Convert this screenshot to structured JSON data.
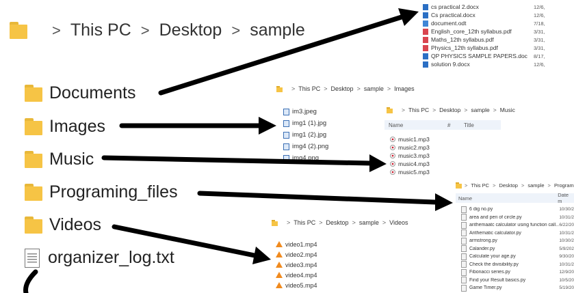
{
  "breadcrumb_main": [
    "This PC",
    "Desktop",
    "sample"
  ],
  "main_list": [
    "Documents",
    "Images",
    "Music",
    "Programing_files",
    "Videos",
    "organizer_log.txt"
  ],
  "documents_panel": {
    "files": [
      {
        "name": "cs practical 2.docx",
        "date": "12/6,",
        "type": "word"
      },
      {
        "name": "Cs practical.docx",
        "date": "12/6,",
        "type": "word"
      },
      {
        "name": "document.odt",
        "date": "7/18,",
        "type": "odt"
      },
      {
        "name": "English_core_12th syllabus.pdf",
        "date": "3/31,",
        "type": "pdf"
      },
      {
        "name": "Maths_12th syllabus.pdf",
        "date": "3/31,",
        "type": "pdf"
      },
      {
        "name": "Physics_12th syllabus.pdf",
        "date": "3/31,",
        "type": "pdf"
      },
      {
        "name": "QP PHYSICS SAMPLE PAPERS.doc",
        "date": "8/17,",
        "type": "word"
      },
      {
        "name": "solution 9.docx",
        "date": "12/6,",
        "type": "word"
      }
    ]
  },
  "images_panel": {
    "breadcrumb": [
      "This PC",
      "Desktop",
      "sample",
      "Images"
    ],
    "files": [
      "im3.jpeg",
      "img1 (1).jpg",
      "img1 (2).jpg",
      "img4 (2).png",
      "img4.png"
    ]
  },
  "music_panel": {
    "breadcrumb": [
      "This PC",
      "Desktop",
      "sample",
      "Music"
    ],
    "col_name": "Name",
    "col_hash": "#",
    "col_title": "Title",
    "files": [
      "music1.mp3",
      "music2.mp3",
      "music3.mp3",
      "music4.mp3",
      "music5.mp3"
    ]
  },
  "prog_panel": {
    "breadcrumb": [
      "This PC",
      "Desktop",
      "sample",
      "Programing_files"
    ],
    "col_name": "Name",
    "col_date": "Date m",
    "files": [
      {
        "name": "6 dig no.py",
        "date": "10/30/2"
      },
      {
        "name": "area and peri of circle.py",
        "date": "10/31/2"
      },
      {
        "name": "arithemaatc calculator using function call...",
        "date": "6/22/20"
      },
      {
        "name": "Arithematic calculator.py",
        "date": "10/31/2"
      },
      {
        "name": "armstrong.py",
        "date": "10/30/2"
      },
      {
        "name": "Calander.py",
        "date": "5/9/202"
      },
      {
        "name": "Calculate your age.py",
        "date": "9/30/20"
      },
      {
        "name": "Check the divisibility.py",
        "date": "10/31/2"
      },
      {
        "name": "Fibonacci series.py",
        "date": "12/9/20"
      },
      {
        "name": "Find your Result basics.py",
        "date": "10/5/20"
      },
      {
        "name": "Game Timer.py",
        "date": "5/19/20"
      }
    ]
  },
  "videos_panel": {
    "breadcrumb": [
      "This PC",
      "Desktop",
      "sample",
      "Videos"
    ],
    "files": [
      "video1.mp4",
      "video2.mp4",
      "video3.mp4",
      "video4.mp4",
      "video5.mp4"
    ]
  }
}
